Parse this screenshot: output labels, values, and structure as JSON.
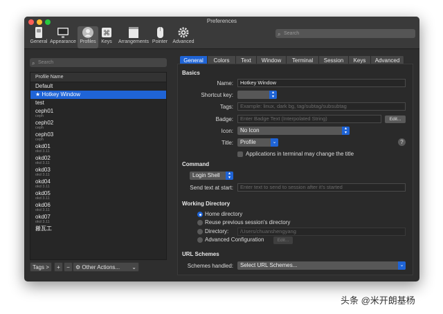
{
  "window": {
    "title": "Preferences"
  },
  "toolbar": [
    {
      "label": "General",
      "icon": "general-switch-icon"
    },
    {
      "label": "Appearance",
      "icon": "appearance-monitor-icon"
    },
    {
      "label": "Profiles",
      "icon": "profiles-person-icon",
      "active": true
    },
    {
      "label": "Keys",
      "icon": "keys-command-icon"
    },
    {
      "label": "Arrangements",
      "icon": "arrangements-windows-icon"
    },
    {
      "label": "Pointer",
      "icon": "pointer-mouse-icon"
    },
    {
      "label": "Advanced",
      "icon": "advanced-gear-icon"
    }
  ],
  "search_top": {
    "placeholder": "Search"
  },
  "left": {
    "search_placeholder": "Search",
    "column_header": "Profile Name",
    "profiles": [
      {
        "name": "Default",
        "sub": ""
      },
      {
        "name": "★ Hotkey Window",
        "sub": "",
        "selected": true
      },
      {
        "name": "test",
        "sub": ""
      },
      {
        "name": "ceph01",
        "sub": "ceph"
      },
      {
        "name": "ceph02",
        "sub": "ceph"
      },
      {
        "name": "ceph03",
        "sub": "ceph"
      },
      {
        "name": "okd01",
        "sub": "okd 3.11"
      },
      {
        "name": "okd02",
        "sub": "okd 3.11"
      },
      {
        "name": "okd03",
        "sub": "okd 3.11"
      },
      {
        "name": "okd04",
        "sub": "okd 3.11"
      },
      {
        "name": "okd05",
        "sub": "okd 3.11"
      },
      {
        "name": "okd06",
        "sub": "okd 3.11"
      },
      {
        "name": "okd07",
        "sub": "okd 3.11"
      },
      {
        "name": "搬瓦工",
        "sub": ""
      }
    ],
    "bottom": {
      "tags": "Tags >",
      "add": "+",
      "remove": "−",
      "other_actions": "Other Actions...",
      "other_actions_icon": "gear-icon"
    }
  },
  "tabs": [
    "General",
    "Colors",
    "Text",
    "Window",
    "Terminal",
    "Session",
    "Keys",
    "Advanced"
  ],
  "basics": {
    "heading": "Basics",
    "name_label": "Name:",
    "name_value": "Hotkey Window",
    "shortcut_label": "Shortcut key:",
    "tags_label": "Tags:",
    "tags_placeholder": "Example: linux, dark bg, tag/subtag/subsubtag",
    "badge_label": "Badge:",
    "badge_placeholder": "Enter Badge Text (Interpolated String)",
    "badge_edit": "Edit...",
    "icon_label": "Icon:",
    "icon_value": "No Icon",
    "title_label": "Title:",
    "title_value": "Profile",
    "checkbox_label": "Applications in terminal may change the title",
    "help": "?"
  },
  "command": {
    "heading": "Command",
    "mode": "Login Shell",
    "send_label": "Send text at start:",
    "send_placeholder": "Enter text to send to session after it’s started"
  },
  "workdir": {
    "heading": "Working Directory",
    "options": [
      "Home directory",
      "Reuse previous session's directory",
      "Directory:",
      "Advanced Configuration"
    ],
    "directory_placeholder": "/Users/chuanshengyang",
    "edit": "Edit..."
  },
  "url": {
    "heading": "URL Schemes",
    "label": "Schemes handled:",
    "value": "Select URL Schemes..."
  },
  "watermark": "头条 @米开朗基杨",
  "colors": {
    "accent": "#1f64d6",
    "window_bg": "#2e2e2e",
    "titlebar": "#3a3a3a",
    "close": "#ff5f57",
    "minimize": "#febc2e",
    "zoom": "#28c840"
  }
}
